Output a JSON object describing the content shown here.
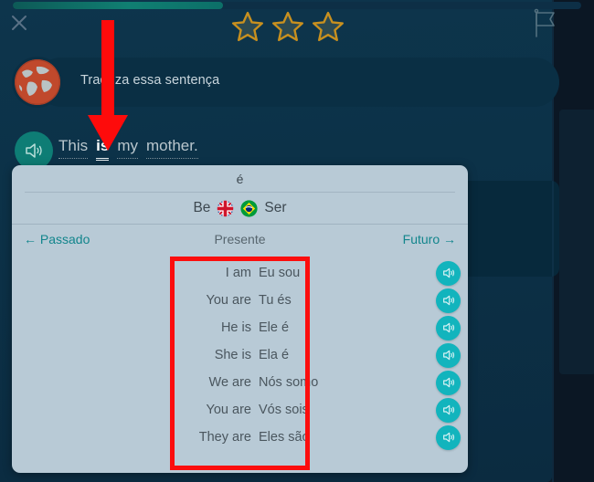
{
  "app": {
    "progress_percent": 37,
    "accent_teal": "#12b4bd",
    "star_color": "#c8901f",
    "panel_bg": "#b8cad6",
    "scene_bg": "#0c3147",
    "annotation_red": "#fc0d0d"
  },
  "topbar": {
    "close_label": "close-x",
    "flag_label": "report-flag",
    "stars": [
      {
        "name": "star-1",
        "filled": false
      },
      {
        "name": "star-2",
        "filled": false
      },
      {
        "name": "star-3",
        "filled": false
      }
    ]
  },
  "prompt": {
    "avatar_icon": "globe-icon",
    "text": "Traduza essa sentença"
  },
  "sentence": {
    "speaker_icon": "speaker-icon",
    "words": [
      {
        "text": "This",
        "selected": false
      },
      {
        "text": "is",
        "selected": true
      },
      {
        "text": "my",
        "selected": false
      },
      {
        "text": "mother.",
        "selected": false
      }
    ]
  },
  "conjugation": {
    "conjugated_form": "é",
    "english_infinitive": "Be",
    "english_flag": "uk-flag-icon",
    "portuguese_flag": "brazil-flag-icon",
    "portuguese_infinitive": "Ser",
    "tense_prev_label": "← Passado",
    "tense_current_label": "Presente",
    "tense_next_label": "Futuro →",
    "rows": [
      {
        "en": "I am",
        "pt": "Eu sou",
        "audio": "speaker-icon"
      },
      {
        "en": "You are",
        "pt": "Tu és",
        "audio": "speaker-icon"
      },
      {
        "en": "He is",
        "pt": "Ele é",
        "audio": "speaker-icon"
      },
      {
        "en": "She is",
        "pt": "Ela é",
        "audio": "speaker-icon"
      },
      {
        "en": "We are",
        "pt": "Nós somo",
        "audio": "speaker-icon"
      },
      {
        "en": "You are",
        "pt": "Vós sois",
        "audio": "speaker-icon"
      },
      {
        "en": "They are",
        "pt": "Eles são",
        "audio": "speaker-icon"
      }
    ]
  },
  "annotations": {
    "arrow": "red-arrow-pointing-to-is",
    "box": "red-box-around-conjugation-list"
  }
}
